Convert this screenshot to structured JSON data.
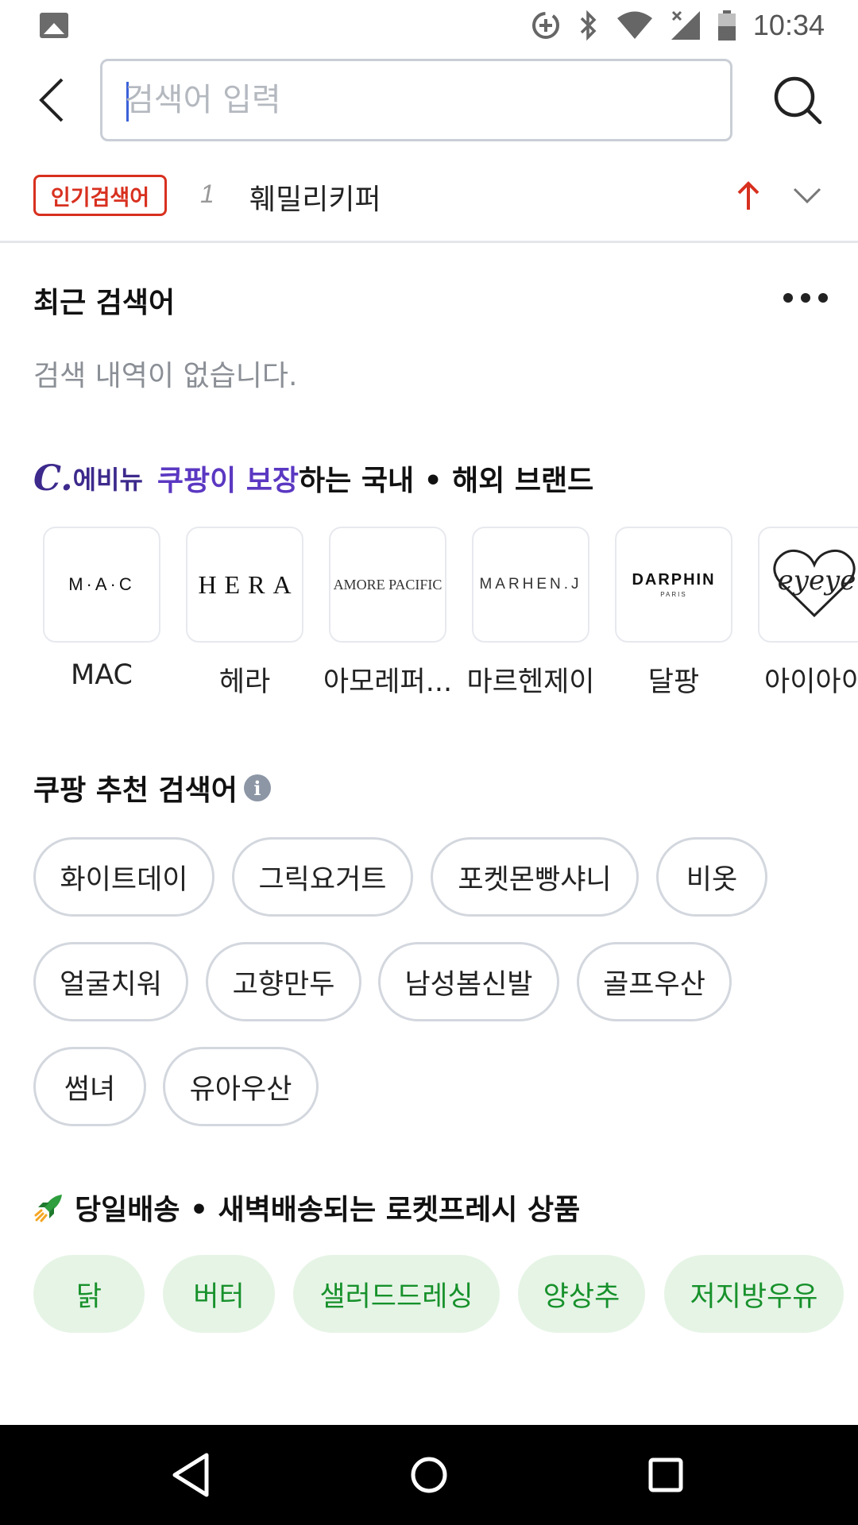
{
  "status_bar": {
    "time": "10:34",
    "icons": [
      "gallery-icon",
      "data-saver-icon",
      "bluetooth-icon",
      "wifi-icon",
      "signal-icon",
      "battery-icon"
    ]
  },
  "search": {
    "placeholder": "검색어 입력",
    "value": ""
  },
  "popular": {
    "badge": "인기검색어",
    "rank": "1",
    "term": "훼밀리키퍼",
    "trend_color": "#d8301f"
  },
  "recent": {
    "title": "최근 검색어",
    "empty_message": "검색 내역이 없습니다."
  },
  "brands": {
    "title_logo_mark": "C.",
    "title_logo_name": "에비뉴",
    "title_accent": "쿠팡이 보장",
    "title_rest": "하는 국내 • 해외 브랜드",
    "accent_color": "#5b38c2",
    "items": [
      {
        "name": "MAC",
        "logo": "M·A·C"
      },
      {
        "name": "헤라",
        "logo": "HERA"
      },
      {
        "name": "아모레퍼...",
        "logo": "AMORE PACIFIC"
      },
      {
        "name": "마르헨제이",
        "logo": "MARHEN.J"
      },
      {
        "name": "달팡",
        "logo": "DARPHIN",
        "logo_sub": "PARIS"
      },
      {
        "name": "아이아이",
        "logo": "eyeye"
      }
    ]
  },
  "recommended": {
    "title": "쿠팡 추천 검색어",
    "info_icon": "i",
    "chips": [
      "화이트데이",
      "그릭요거트",
      "포켓몬빵샤니",
      "비옷",
      "얼굴치워",
      "고향만두",
      "남성봄신발",
      "골프우산",
      "썸녀",
      "유아우산"
    ]
  },
  "fresh": {
    "title": "당일배송 • 새벽배송되는 로켓프레시 상품",
    "chip_color": "#17912b",
    "chips": [
      "닭",
      "버터",
      "샐러드드레싱",
      "양상추",
      "저지방우유"
    ]
  },
  "nav": {
    "icons": [
      "back-triangle-icon",
      "home-circle-icon",
      "recents-square-icon"
    ]
  }
}
